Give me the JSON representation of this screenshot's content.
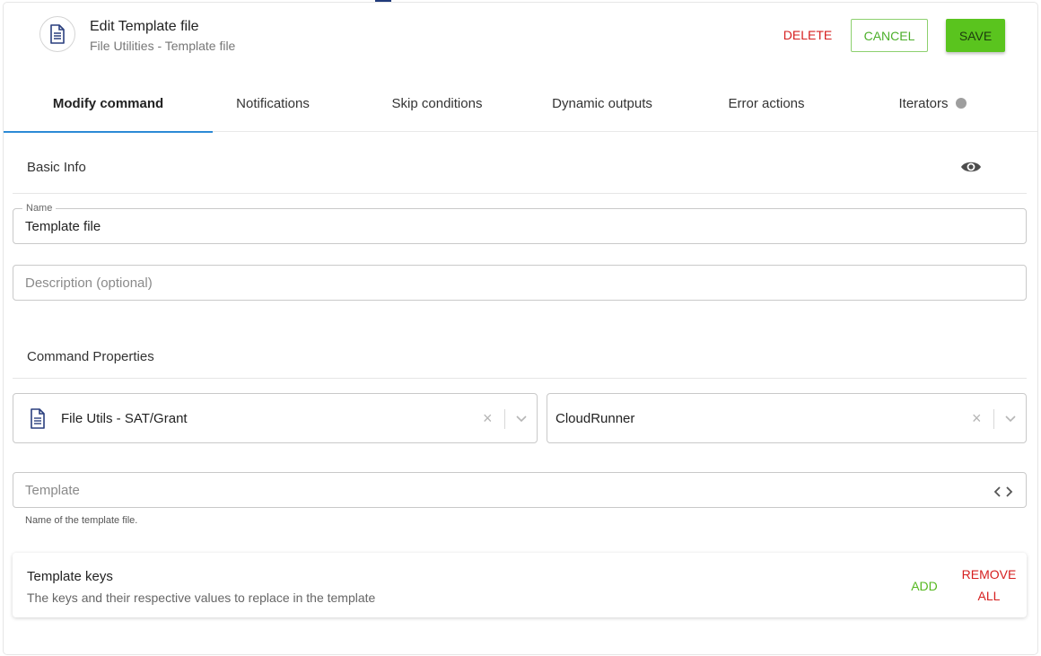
{
  "header": {
    "title": "Edit Template file",
    "subtitle": "File Utilities - Template file",
    "icon": "document-icon"
  },
  "actions": {
    "delete_label": "DELETE",
    "cancel_label": "CANCEL",
    "save_label": "SAVE"
  },
  "tabs": [
    {
      "label": "Modify command",
      "active": true
    },
    {
      "label": "Notifications"
    },
    {
      "label": "Skip conditions"
    },
    {
      "label": "Dynamic outputs"
    },
    {
      "label": "Error actions"
    },
    {
      "label": "Iterators"
    }
  ],
  "basic_info": {
    "title": "Basic Info",
    "name_label": "Name",
    "name_value": "Template file",
    "description_placeholder": "Description (optional)"
  },
  "command_properties": {
    "title": "Command Properties",
    "integration_value": "File Utils - SAT/Grant",
    "runner_value": "CloudRunner",
    "clear_symbol": "×",
    "template_placeholder": "Template",
    "template_helper": "Name of the template file."
  },
  "template_keys": {
    "title": "Template keys",
    "subtitle": "The keys and their respective values to replace in the template",
    "add_label": "ADD",
    "remove_line1": "REMOVE",
    "remove_line2": "ALL"
  },
  "colors": {
    "accent_tab": "#2c8ad6",
    "save_green": "#5ac41e",
    "danger_red": "#d61f1f",
    "iterator_dot": "#9e9e9e"
  }
}
